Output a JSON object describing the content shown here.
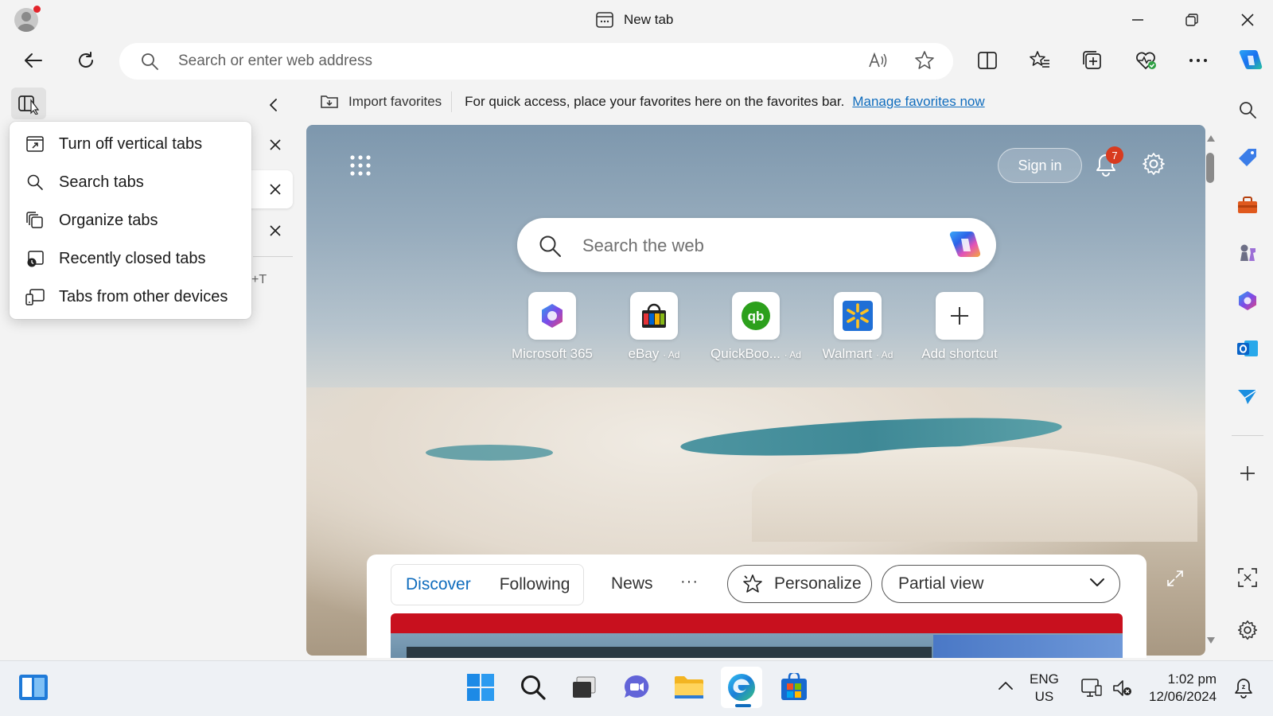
{
  "window": {
    "tab_title": "New tab"
  },
  "toolbar": {
    "address_placeholder": "Search or enter web address"
  },
  "favorites_bar": {
    "import_label": "Import favorites",
    "message": "For quick access, place your favorites here on the favorites bar.",
    "manage_link": "Manage favorites now"
  },
  "vertical_tabs": {
    "new_tab_hint": "+T"
  },
  "context_menu": {
    "items": [
      {
        "label": "Turn off vertical tabs",
        "icon": "vertical-tabs-off-icon"
      },
      {
        "label": "Search tabs",
        "icon": "search-icon"
      },
      {
        "label": "Organize tabs",
        "icon": "organize-tabs-icon"
      },
      {
        "label": "Recently closed tabs",
        "icon": "recently-closed-icon"
      },
      {
        "label": "Tabs from other devices",
        "icon": "devices-icon"
      }
    ]
  },
  "newtab": {
    "sign_in": "Sign in",
    "notification_count": "7",
    "search_placeholder": "Search the web",
    "shortcuts": [
      {
        "label": "Microsoft 365",
        "ad": "",
        "icon": "microsoft-365-icon"
      },
      {
        "label": "eBay",
        "ad": "· Ad",
        "icon": "ebay-icon"
      },
      {
        "label": "QuickBoo...",
        "ad": "· Ad",
        "icon": "quickbooks-icon"
      },
      {
        "label": "Walmart",
        "ad": "· Ad",
        "icon": "walmart-icon"
      },
      {
        "label": "Add shortcut",
        "ad": "",
        "icon": "plus-icon"
      }
    ]
  },
  "feed": {
    "tabs": [
      "Discover",
      "Following"
    ],
    "news": "News",
    "more": "···",
    "personalize": "Personalize",
    "view_select": "Partial view"
  },
  "taskbar": {
    "lang_line1": "ENG",
    "lang_line2": "US",
    "time": "1:02 pm",
    "date": "12/06/2024"
  },
  "colors": {
    "accent": "#0f6cbd",
    "badge": "#d83b1f"
  }
}
